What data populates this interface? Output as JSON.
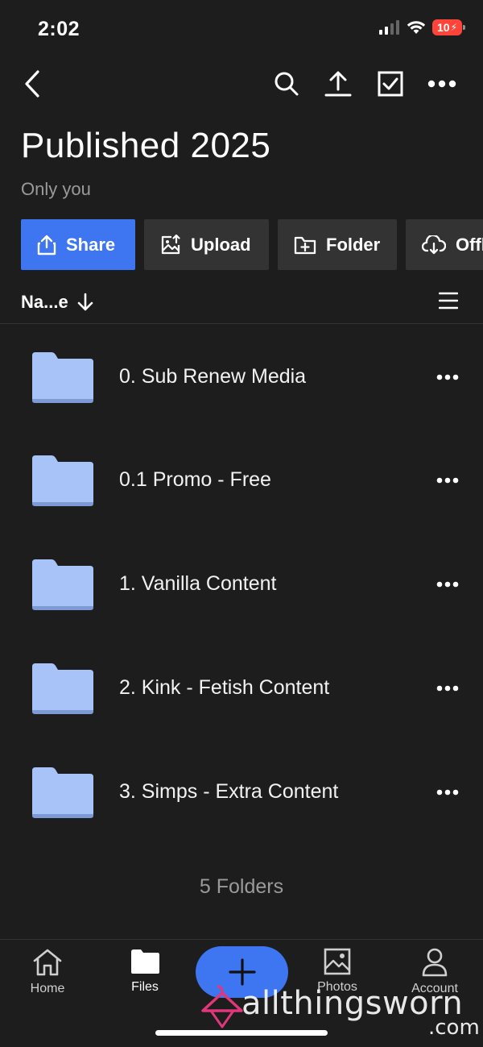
{
  "status_bar": {
    "time": "2:02",
    "battery": "10"
  },
  "folder": {
    "title": "Published 2025",
    "sharing": "Only you"
  },
  "actions": [
    {
      "label": "Share",
      "icon": "share-icon"
    },
    {
      "label": "Upload",
      "icon": "upload-photo-icon"
    },
    {
      "label": "Folder",
      "icon": "new-folder-icon"
    },
    {
      "label": "Offl",
      "icon": "cloud-download-icon"
    }
  ],
  "sort": {
    "label": "Na...e",
    "direction_icon": "arrow-down-icon"
  },
  "items": [
    {
      "name": "0. Sub Renew Media"
    },
    {
      "name": "0.1 Promo - Free"
    },
    {
      "name": "1. Vanilla Content"
    },
    {
      "name": "2. Kink - Fetish Content"
    },
    {
      "name": "3. Simps - Extra Content"
    }
  ],
  "summary": "5 Folders",
  "tabs": [
    {
      "label": "Home",
      "icon": "home-icon"
    },
    {
      "label": "Files",
      "icon": "folder-icon"
    },
    {
      "label": "Photos",
      "icon": "photos-icon"
    },
    {
      "label": "Account",
      "icon": "account-icon"
    }
  ],
  "watermark": {
    "text": "allthingsworn",
    "suffix": ".com"
  },
  "colors": {
    "accent": "#3d76f0",
    "background": "#1d1d1d",
    "folder": "#a8c3f7",
    "button": "#333333"
  }
}
